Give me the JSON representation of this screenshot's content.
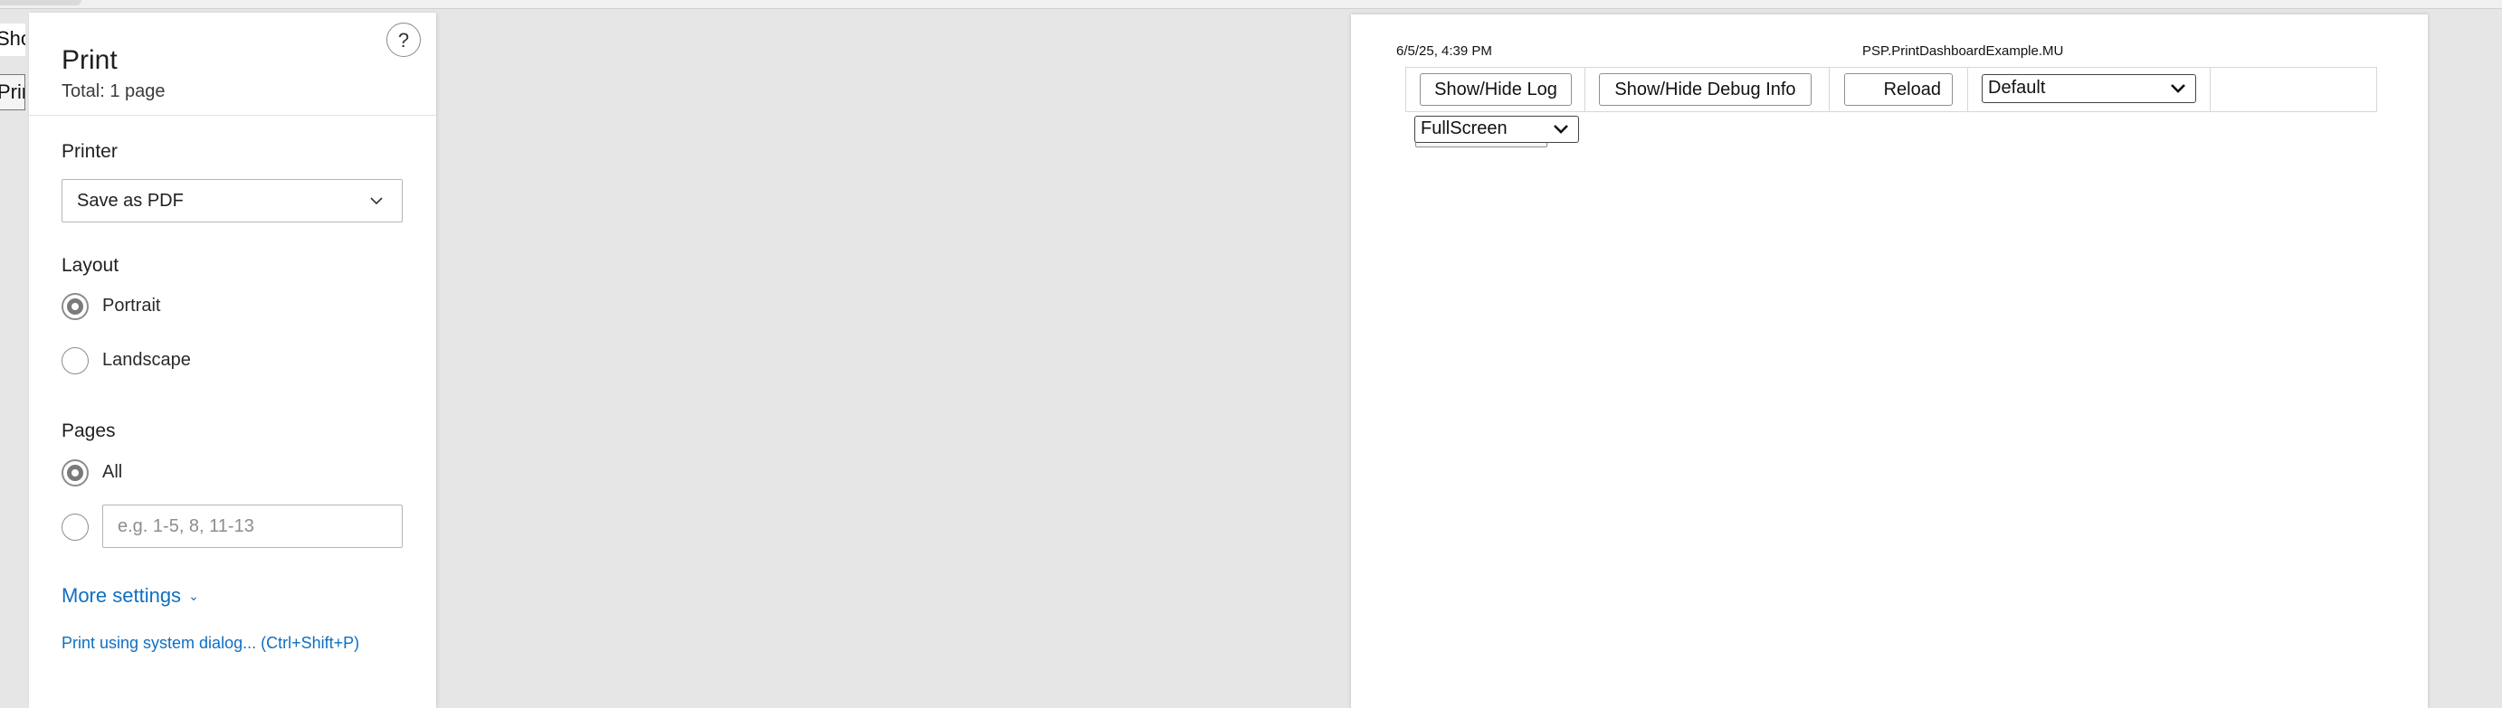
{
  "background_page": {
    "button_fragment_1": "Show/Hide Log",
    "button_fragment_2": "Print"
  },
  "print_panel": {
    "title": "Print",
    "subtitle": "Total: 1 page",
    "help_label": "?",
    "printer": {
      "label": "Printer",
      "selected": "Save as PDF"
    },
    "layout": {
      "label": "Layout",
      "options": [
        {
          "label": "Portrait",
          "checked": true
        },
        {
          "label": "Landscape",
          "checked": false
        }
      ]
    },
    "pages": {
      "label": "Pages",
      "all_label": "All",
      "all_checked": true,
      "custom_placeholder": "e.g. 1-5, 8, 11-13",
      "custom_value": ""
    },
    "more_settings": "More settings",
    "system_dialog": "Print using system dialog... (Ctrl+Shift+P)"
  },
  "preview": {
    "header_date": "6/5/25, 4:39 PM",
    "header_title": "PSP.PrintDashboardExample.MU",
    "toolbar": {
      "show_hide_log": "Show/Hide Log",
      "show_hide_debug": "Show/Hide Debug Info",
      "reload": "Reload",
      "dropdown_value": "Default"
    },
    "fullscreen_select": "FullScreen"
  },
  "colors": {
    "accent_link": "#0e6fc2",
    "panel_bg": "#ffffff",
    "canvas_bg": "#e6e6e6"
  }
}
